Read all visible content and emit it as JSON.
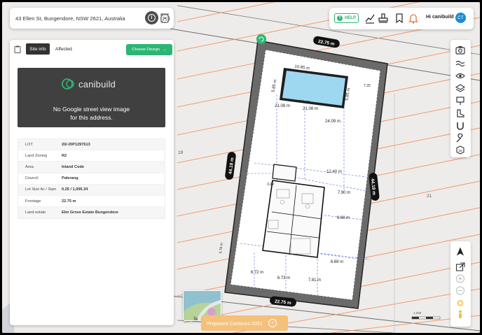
{
  "search": {
    "address": "43 Ellen St, Bungendore, NSW 2621, Australia",
    "clear_glyph": "×"
  },
  "topbar": {
    "help_label": "HELP",
    "user_label": "Hi canibuild",
    "user_initials": "CT"
  },
  "panel": {
    "tabs": [
      {
        "label": "Site info",
        "active": true
      },
      {
        "label": "Affected",
        "active": false
      }
    ],
    "choose_design_label": "Choose Design",
    "brand": "canibuild",
    "street_view_message_line1": "No Google street view image",
    "street_view_message_line2": "for this address.",
    "site_info": [
      {
        "key": "LOT",
        "value": "20/-/DP1297613"
      },
      {
        "key": "Land Zoning",
        "value": "R2"
      },
      {
        "key": "Area",
        "value": "Inland Code"
      },
      {
        "key": "Council",
        "value": "Palerang"
      },
      {
        "key": "Lot Size Ac / Sqm",
        "value": "0.25 / 1,005.34"
      },
      {
        "key": "Frontage",
        "value": "22.75 m"
      },
      {
        "key": "Land estate",
        "value": "Elm Grove Estate Bungendore"
      }
    ]
  },
  "map": {
    "lot_numbers": {
      "left": "19",
      "right": "21"
    },
    "dimensions": {
      "top_frontage": "22.75 m",
      "bottom_frontage": "22.75 m",
      "left_side": "44.18 m",
      "right_side": "44.18 m",
      "pool_top_width": "10.85 m",
      "pool_bottom_width": "10.85 m",
      "pool_left": "5.85 m",
      "pool_right": "5.85 m",
      "d1": "21.08 m",
      "d2": "21.08 m",
      "d3": "24.09 m",
      "d4": "12.40 m",
      "d5": "7.90 m",
      "d6": "6.68 m",
      "d7": "6.69 m",
      "d8": "6.72 m",
      "d9": "6.73 m",
      "d10": "7.81 m",
      "d11": "5.76 m",
      "corner_a": "7.25",
      "corner_b": "3.29"
    },
    "scale_label": "1:250",
    "contours_label": "Proposed Contours 2021",
    "thumb_label": "Te"
  },
  "colors": {
    "accent": "#2bb673",
    "contour": "#f29a6b",
    "pool": "#9ed8f0",
    "avatar": "#1a8bd6"
  }
}
